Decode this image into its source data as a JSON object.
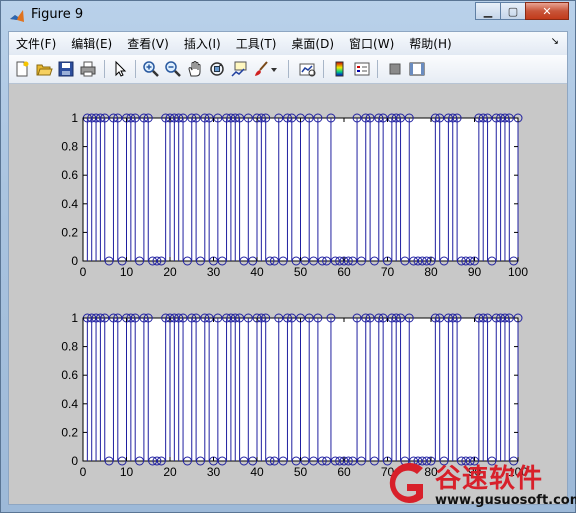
{
  "window": {
    "title": "Figure 9",
    "minimize_glyph": "▁",
    "maximize_glyph": "▢",
    "close_glyph": "✕"
  },
  "menubar": {
    "items": [
      "文件(F)",
      "编辑(E)",
      "查看(V)",
      "插入(I)",
      "工具(T)",
      "桌面(D)",
      "窗口(W)",
      "帮助(H)"
    ],
    "overflow_glyph": "↘"
  },
  "toolbar": {
    "icons": [
      "new-figure-icon",
      "open-file-icon",
      "save-icon",
      "print-icon",
      "select-arrow-icon",
      "zoom-in-icon",
      "zoom-out-icon",
      "pan-hand-icon",
      "rotate-3d-icon",
      "data-cursor-icon",
      "brush-icon",
      "brush-dropdown-icon",
      "link-plot-icon",
      "colorbar-icon",
      "legend-icon",
      "hide-plot-tools-icon",
      "show-plot-tools-icon"
    ]
  },
  "colors": {
    "stem": "#1f1fa0",
    "marker": "#1f1fa0",
    "axes_bg": "#ffffff",
    "figure_bg": "#c8c8c8",
    "watermark_red": "#d8202a"
  },
  "chart_data": [
    {
      "type": "stem",
      "xlim": [
        0,
        100
      ],
      "ylim": [
        0,
        1
      ],
      "xticks": [
        0,
        10,
        20,
        30,
        40,
        50,
        60,
        70,
        80,
        90,
        100
      ],
      "yticks": [
        0,
        0.2,
        0.4,
        0.6,
        0.8,
        1
      ],
      "ytick_labels": [
        "0",
        "0.2",
        "0.4",
        "0.6",
        "0.8",
        "1"
      ],
      "x_start": 1,
      "values": [
        1,
        1,
        1,
        1,
        1,
        0,
        1,
        1,
        0,
        1,
        1,
        1,
        0,
        1,
        1,
        0,
        0,
        0,
        1,
        1,
        1,
        1,
        1,
        0,
        1,
        1,
        0,
        1,
        1,
        0,
        1,
        0,
        1,
        1,
        1,
        1,
        0,
        1,
        0,
        1,
        1,
        1,
        0,
        0,
        1,
        0,
        1,
        1,
        0,
        1,
        0,
        1,
        0,
        1,
        0,
        0,
        1,
        0,
        0,
        0,
        0,
        0,
        1,
        0,
        1,
        1,
        0,
        1,
        1,
        0,
        1,
        1,
        1,
        0,
        1,
        0,
        0,
        0,
        0,
        0,
        1,
        1,
        0,
        1,
        1,
        1,
        0,
        0,
        0,
        0,
        1,
        1,
        1,
        0,
        1,
        1,
        1,
        1,
        0,
        1
      ],
      "markers_top": [
        1,
        2,
        3,
        4,
        5,
        7,
        8,
        10,
        11,
        12,
        14,
        15,
        19,
        20,
        21,
        22,
        23,
        25,
        26,
        28,
        29,
        31,
        33,
        34,
        35,
        36,
        38,
        40,
        41,
        42,
        45,
        47,
        48,
        50,
        52,
        54,
        57,
        63,
        65,
        66,
        68,
        69,
        71,
        72,
        73,
        75,
        81,
        82,
        84,
        85,
        86,
        91,
        92,
        93,
        95,
        96,
        97,
        98,
        100
      ]
    },
    {
      "type": "stem",
      "xlim": [
        0,
        100
      ],
      "ylim": [
        0,
        1
      ],
      "xticks": [
        0,
        10,
        20,
        30,
        40,
        50,
        60,
        70,
        80,
        90,
        100
      ],
      "yticks": [
        0,
        0.2,
        0.4,
        0.6,
        0.8,
        1
      ],
      "ytick_labels": [
        "0",
        "0.2",
        "0.4",
        "0.6",
        "0.8",
        "1"
      ],
      "x_start": 1,
      "values": [
        1,
        1,
        1,
        1,
        1,
        0,
        1,
        1,
        0,
        1,
        1,
        1,
        0,
        1,
        1,
        0,
        0,
        0,
        1,
        1,
        1,
        1,
        1,
        0,
        1,
        1,
        0,
        1,
        1,
        0,
        1,
        0,
        1,
        1,
        1,
        1,
        0,
        1,
        0,
        1,
        1,
        1,
        0,
        0,
        1,
        0,
        1,
        1,
        0,
        1,
        0,
        1,
        0,
        1,
        0,
        0,
        1,
        0,
        0,
        0,
        0,
        0,
        1,
        0,
        1,
        1,
        0,
        1,
        1,
        0,
        1,
        1,
        1,
        0,
        1,
        0,
        0,
        0,
        0,
        0,
        1,
        1,
        0,
        1,
        1,
        1,
        0,
        0,
        0,
        0,
        1,
        1,
        1,
        0,
        1,
        1,
        1,
        1,
        0,
        1
      ]
    }
  ],
  "watermark": {
    "name": "谷速软件",
    "url": "www.gusuosoft.com"
  }
}
